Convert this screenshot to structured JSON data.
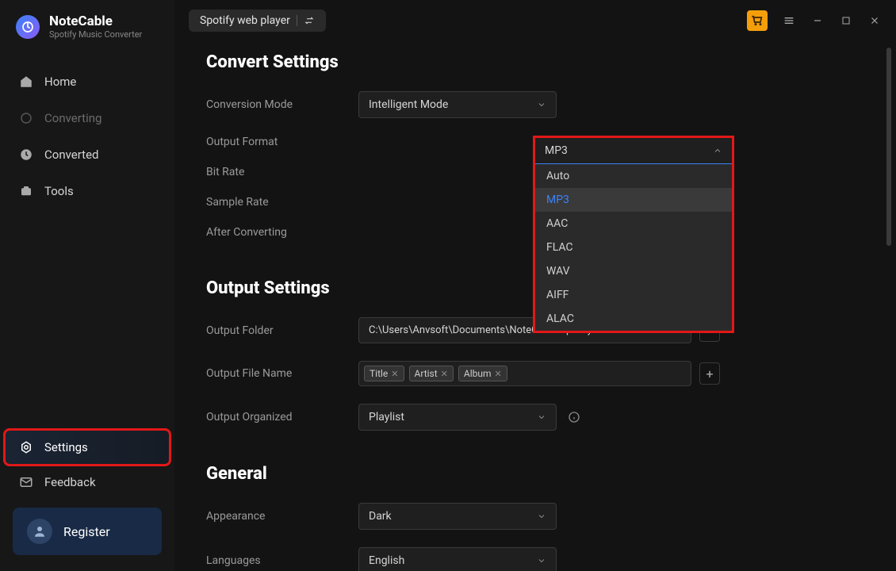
{
  "logo": {
    "title": "NoteCable",
    "subtitle": "Spotify Music Converter"
  },
  "nav": {
    "home": "Home",
    "converting": "Converting",
    "converted": "Converted",
    "tools": "Tools",
    "settings": "Settings",
    "feedback": "Feedback",
    "register": "Register"
  },
  "topbar": {
    "source": "Spotify web player"
  },
  "sections": {
    "convert": "Convert Settings",
    "output": "Output Settings",
    "general": "General"
  },
  "convert": {
    "conversion_mode_label": "Conversion Mode",
    "conversion_mode_value": "Intelligent Mode",
    "output_format_label": "Output Format",
    "output_format_value": "MP3",
    "output_format_options": [
      "Auto",
      "MP3",
      "AAC",
      "FLAC",
      "WAV",
      "AIFF",
      "ALAC"
    ],
    "bit_rate_label": "Bit Rate",
    "sample_rate_label": "Sample Rate",
    "after_converting_label": "After Converting"
  },
  "output": {
    "folder_label": "Output Folder",
    "folder_value": "C:\\Users\\Anvsoft\\Documents\\NoteCable Spotify Music Con",
    "filename_label": "Output File Name",
    "filename_tags": [
      "Title",
      "Artist",
      "Album"
    ],
    "organized_label": "Output Organized",
    "organized_value": "Playlist"
  },
  "general": {
    "appearance_label": "Appearance",
    "appearance_value": "Dark",
    "languages_label": "Languages",
    "languages_value": "English"
  }
}
